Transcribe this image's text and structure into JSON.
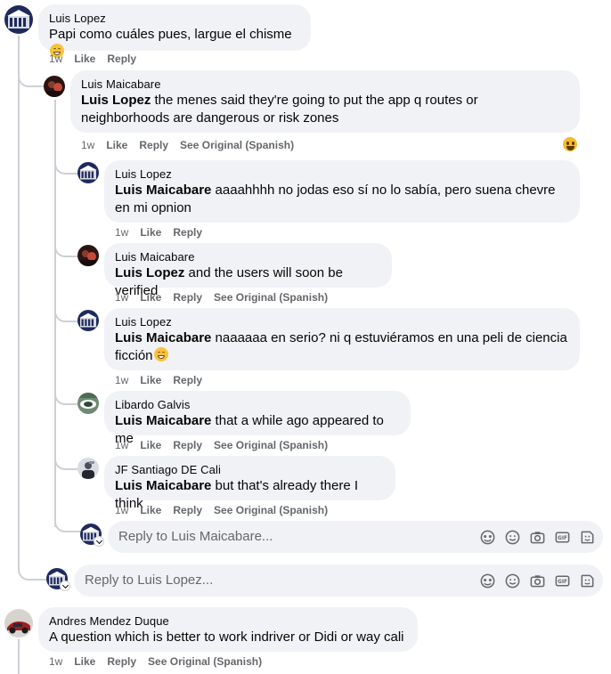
{
  "comments": [
    {
      "author": "Luis Lopez",
      "mention": "",
      "text": "Papi como cuáles pues, largue el chisme",
      "time": "1w",
      "like": "Like",
      "reply": "Reply",
      "see_original": ""
    },
    {
      "author": "Luis Maicabare",
      "mention": "Luis Lopez",
      "text": " the menes said they're going to put the app q routes or neighborhoods are dangerous or risk zones",
      "time": "1w",
      "like": "Like",
      "reply": "Reply",
      "see_original": "See Original (Spanish)"
    },
    {
      "author": "Luis Lopez",
      "mention": "Luis Maicabare",
      "text": " aaaahhhh no jodas eso sí no lo sabía, pero suena chevre en mi opnion",
      "time": "1w",
      "like": "Like",
      "reply": "Reply",
      "see_original": ""
    },
    {
      "author": "Luis Maicabare",
      "mention": "Luis Lopez",
      "text": " and the users will soon be verified",
      "time": "1w",
      "like": "Like",
      "reply": "Reply",
      "see_original": "See Original (Spanish)"
    },
    {
      "author": "Luis Lopez",
      "mention": "Luis Maicabare",
      "text": " naaaaaa en serio? ni q estuviéramos en una peli de ciencia ficción",
      "time": "1w",
      "like": "Like",
      "reply": "Reply",
      "see_original": ""
    },
    {
      "author": "Libardo Galvis",
      "mention": "Luis Maicabare",
      "text": " that a while ago appeared to me",
      "time": "1w",
      "like": "Like",
      "reply": "Reply",
      "see_original": "See Original (Spanish)"
    },
    {
      "author": "JF Santiago DE Cali",
      "mention": "Luis Maicabare",
      "text": " but that's already there I think",
      "time": "1w",
      "like": "Like",
      "reply": "Reply",
      "see_original": "See Original (Spanish)"
    },
    {
      "author": "Andres Mendez Duque",
      "mention": "",
      "text": "A question which is better to work indriver or Didi or way cali",
      "time": "1w",
      "like": "Like",
      "reply": "Reply",
      "see_original": "See Original (Spanish)"
    }
  ],
  "reply_boxes": [
    {
      "placeholder": "Reply to Luis Maicabare..."
    },
    {
      "placeholder": "Reply to Luis Lopez..."
    }
  ],
  "reply_icons": [
    "emoji-avatar-icon",
    "smiley-icon",
    "camera-icon",
    "gif-icon",
    "sticker-icon"
  ],
  "reaction": "haha-reaction-icon",
  "colors": {
    "bubble": "#f0f2f5",
    "meta_text": "#65676b",
    "thread_line": "#ced0d4"
  }
}
